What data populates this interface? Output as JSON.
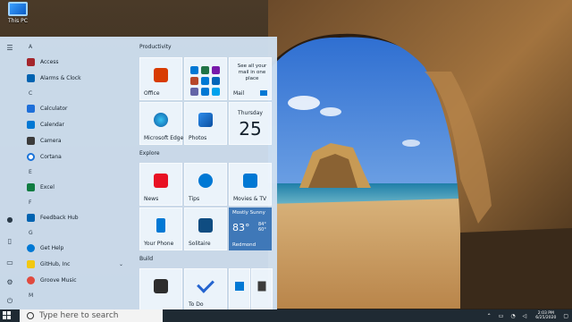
{
  "desktop": {
    "icon_label": "This PC"
  },
  "start": {
    "letters": [
      "A",
      "C",
      "E",
      "F",
      "G",
      "M"
    ],
    "apps": [
      {
        "label": "Access",
        "color": "#a4262c",
        "chev": false
      },
      {
        "label": "Alarms & Clock",
        "color": "#0063b1",
        "chev": false
      },
      {
        "label": "Calculator",
        "color": "#1e6fd9",
        "chev": false
      },
      {
        "label": "Calendar",
        "color": "#0078d4",
        "chev": false
      },
      {
        "label": "Camera",
        "color": "#3b3b3b",
        "chev": false
      },
      {
        "label": "Cortana",
        "color": "#1a73d9",
        "chev": false
      },
      {
        "label": "Excel",
        "color": "#107c41",
        "chev": false
      },
      {
        "label": "Feedback Hub",
        "color": "#0063b1",
        "chev": false
      },
      {
        "label": "Get Help",
        "color": "#0078d4",
        "chev": false
      },
      {
        "label": "GitHub, Inc",
        "color": "#f2c811",
        "chev": true
      },
      {
        "label": "Groove Music",
        "color": "#e04a3f",
        "chev": false
      }
    ],
    "groups": {
      "productivity": "Productivity",
      "explore": "Explore",
      "build": "Build"
    },
    "tiles": {
      "office": "Office",
      "mail_text": "See all your mail in one place",
      "mail": "Mail",
      "edge": "Microsoft Edge",
      "photos": "Photos",
      "cal_day": "Thursday",
      "cal_num": "25",
      "news": "News",
      "tips": "Tips",
      "movies": "Movies & TV",
      "phone": "Your Phone",
      "solitaire": "Solitaire",
      "weather_cond": "Mostly Sunny",
      "weather_temp": "83°",
      "weather_hi": "84°",
      "weather_lo": "60°",
      "weather_city": "Redmond",
      "terminal": "",
      "todo": "To Do",
      "vscode": "",
      "calc": ""
    }
  },
  "taskbar": {
    "search_placeholder": "Type here to search",
    "clock_time": "2:03 PM",
    "clock_date": "6/25/2020"
  },
  "colors": {
    "accent": "#0078d4",
    "taskbar": "#1f2a33",
    "menu": "#cfe0f0"
  }
}
